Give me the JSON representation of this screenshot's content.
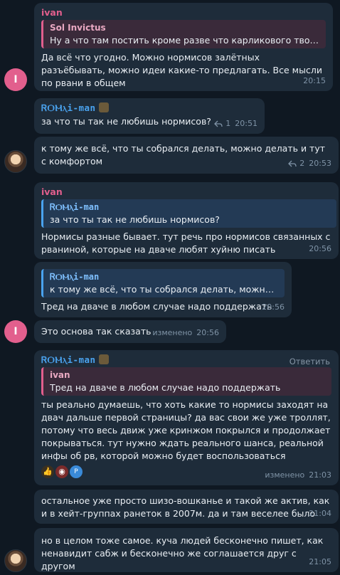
{
  "messages": {
    "m1": {
      "sender": "ivan",
      "quote_name": "Sol Invictus",
      "quote_text": "Ну а что там постить кроме разве что карликового творчест…",
      "text": "Да всё что угодно. Можно нормисов залётных разъёбывать, можно идеи какие-то предлагать. Все мысли по рвани в общем",
      "time": "20:15",
      "avatar": "I"
    },
    "m2": {
      "sender": "ᏒѺⲘⲗi-man",
      "text": "за что ты так не любишь нормисов?",
      "replies": "1",
      "time": "20:51"
    },
    "m3": {
      "text": "к тому же всё, что ты собрался делать, можно делать и тут с комфортом",
      "replies": "2",
      "time": "20:53"
    },
    "m4": {
      "sender": "ivan",
      "quote_name": "ᏒѺⲘⲗi-man",
      "quote_text": "за что ты так не любишь нормисов?",
      "text": "Нормисы разные бывает. тут речь про нормисов связанных с рваниной, которые на дваче любят хуйню писать",
      "time": "20:56"
    },
    "m5": {
      "quote_name": "ᏒѺⲘⲗi-man",
      "quote_text": "к тому же всё, что ты собрался делать, можно дел…",
      "text": "Тред на дваче в любом случае надо поддержать",
      "time": "20:56"
    },
    "m6": {
      "text": "Это основа так сказать",
      "edited": "изменено",
      "time": "20:56",
      "avatar": "I"
    },
    "m7": {
      "sender": "ᏒѺⲘⲗi-man",
      "reply_button": "Ответить",
      "quote_name": "ivan",
      "quote_text": "Тред на дваче в любом случае надо поддержать",
      "text": "ты реально думаешь, что хоть какие то нормисы заходят на двач дальше первой страницы? да вас свои же уже троллят, потому что весь движ уже кринжом покрылся и продолжает покрываться. тут нужно ждать реального шанса, реальной инфы об рв, которой можно будет воспользоваться",
      "reaction_count": "P",
      "edited": "изменено",
      "time": "21:03"
    },
    "m8": {
      "text": "остальное уже просто шизо-вошканье и такой же актив, как и в хейт-группах ранеток в 2007м. да и там веселее было",
      "time": "21:04"
    },
    "m9": {
      "text": "но в целом тоже самое. куча людей бесконечно пишет, как ненавидит сабж и бесконечно же соглашается друг с другом",
      "time": "21:05"
    }
  },
  "colors": {
    "background": "#0f1822",
    "bubble": "#1e2c3a",
    "ivan": "#e25f8d",
    "romi": "#4aa3ef"
  }
}
